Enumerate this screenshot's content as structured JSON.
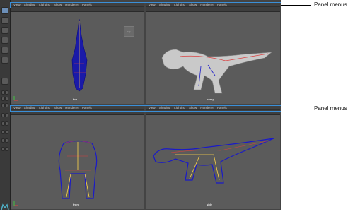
{
  "panel_menus": [
    "View",
    "Shading",
    "Lighting",
    "Show",
    "Renderer",
    "Panels"
  ],
  "viewports": {
    "top_left": {
      "label": "top"
    },
    "top_right": {
      "label": "persp"
    },
    "bottom_left": {
      "label": "front"
    },
    "bottom_right": {
      "label": "side"
    }
  },
  "callouts": {
    "upper": "Panel menus",
    "lower": "Panel menus"
  },
  "colors": {
    "callout_box": "#3a8fd8",
    "viewport_bg": "#5b5b5b",
    "wireframe": "#1a1ac8",
    "skeleton": "#ffd54a"
  }
}
